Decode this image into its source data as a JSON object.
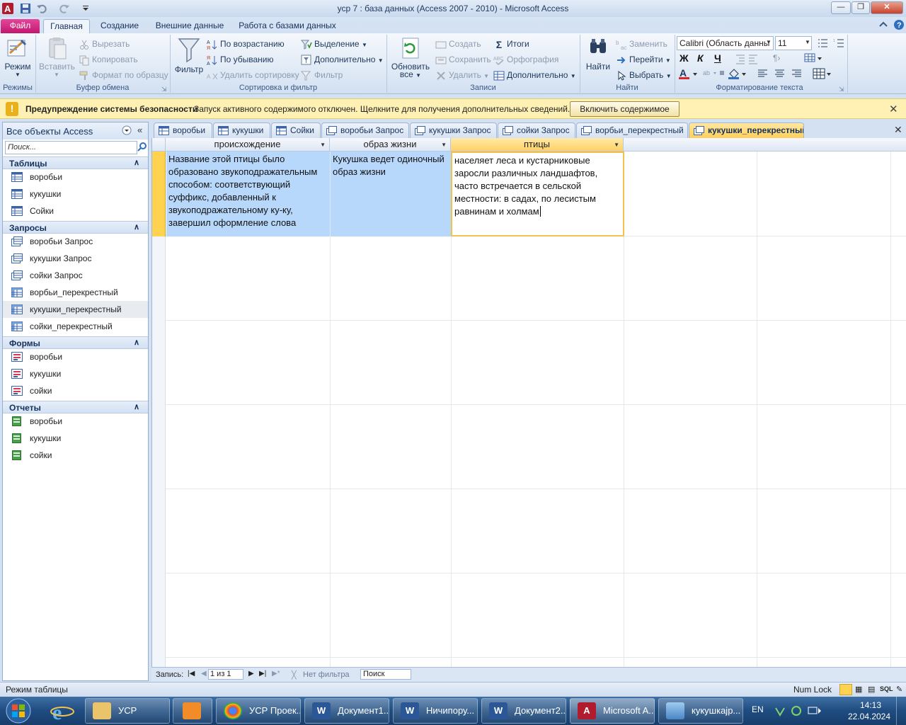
{
  "window": {
    "title": "уср 7 : база данных (Access 2007 - 2010)  -  Microsoft Access"
  },
  "ribbon_tabs": [
    "Файл",
    "Главная",
    "Создание",
    "Внешние данные",
    "Работа с базами данных"
  ],
  "ribbon": {
    "modes": {
      "view_label": "Режим",
      "group": "Режимы"
    },
    "clipboard": {
      "paste": "Вставить",
      "cut": "Вырезать",
      "copy": "Копировать",
      "format_painter": "Формат по образцу",
      "group": "Буфер обмена"
    },
    "sort_filter": {
      "filter": "Фильтр",
      "asc": "По возрастанию",
      "desc": "По убыванию",
      "remove_sort": "Удалить сортировку",
      "selection": "Выделение",
      "advanced": "Дополнительно",
      "toggle_filter": "Фильтр",
      "group": "Сортировка и фильтр"
    },
    "records": {
      "refresh": "Обновить",
      "refresh2": "все",
      "new": "Создать",
      "save": "Сохранить",
      "delete": "Удалить",
      "totals": "Итоги",
      "spelling": "Орфография",
      "more": "Дополнительно",
      "group": "Записи"
    },
    "find": {
      "find": "Найти",
      "replace": "Заменить",
      "goto": "Перейти",
      "select": "Выбрать",
      "group": "Найти"
    },
    "text": {
      "font": "Calibri (Область данны",
      "size": "11",
      "bold": "Ж",
      "italic": "К",
      "underline": "Ч",
      "group": "Форматирование текста"
    }
  },
  "security": {
    "title": "Предупреждение системы безопасности",
    "message": "Запуск активного содержимого отключен. Щелкните для получения дополнительных сведений.",
    "button": "Включить содержимое"
  },
  "nav": {
    "header": "Все объекты Access",
    "search_placeholder": "Поиск...",
    "categories": [
      {
        "name": "Таблицы",
        "items": [
          "воробьи",
          "кукушки",
          "Сойки"
        ]
      },
      {
        "name": "Запросы",
        "items": [
          "воробьи Запрос",
          "кукушки Запрос",
          "сойки Запрос",
          "ворбьи_перекрестный",
          "кукушки_перекрестный",
          "сойки_перекрестный"
        ]
      },
      {
        "name": "Формы",
        "items": [
          "воробьи",
          "кукушки",
          "сойки"
        ]
      },
      {
        "name": "Отчеты",
        "items": [
          "воробьи",
          "кукушки",
          "сойки"
        ]
      }
    ]
  },
  "doc_tabs": [
    "воробьи",
    "кукушки",
    "Сойки",
    "воробьи Запрос",
    "кукушки Запрос",
    "сойки Запрос",
    "ворбьи_перекрестный",
    "кукушки_перекрестный"
  ],
  "datasheet": {
    "columns": [
      "происхождение",
      "образ жизни",
      "птицы"
    ],
    "row": [
      "Название этой птицы было образовано звукоподражательным  способом: соответствующий суффикс, добавленный к звукоподражательному ку-ку, завершил оформление слова",
      "Кукушка ведет одиночный образ жизни",
      "населяет леса и кустарниковые заросли различных ландшафтов, часто встречается в сельской местности: в садах, по лесистым равнинам и холмам"
    ]
  },
  "record_nav": {
    "label": "Запись:",
    "position": "1 из 1",
    "filter": "Нет фильтра",
    "search": "Поиск"
  },
  "status": {
    "left": "Режим таблицы",
    "numlock": "Num Lock"
  },
  "taskbar": {
    "items": [
      "УСР",
      "",
      "УСР Проек...",
      "Документ1...",
      "Ничипору...",
      "Документ2...",
      "Microsoft A...",
      "кукушкаjр..."
    ],
    "lang": "EN",
    "time": "14:13",
    "date": "22.04.2024"
  },
  "colors": {
    "accent_file": "#c2186f",
    "active_tab": "#ffcf5c",
    "selected_row": "#b7d7fb",
    "record_selector": "#ffd24f"
  }
}
